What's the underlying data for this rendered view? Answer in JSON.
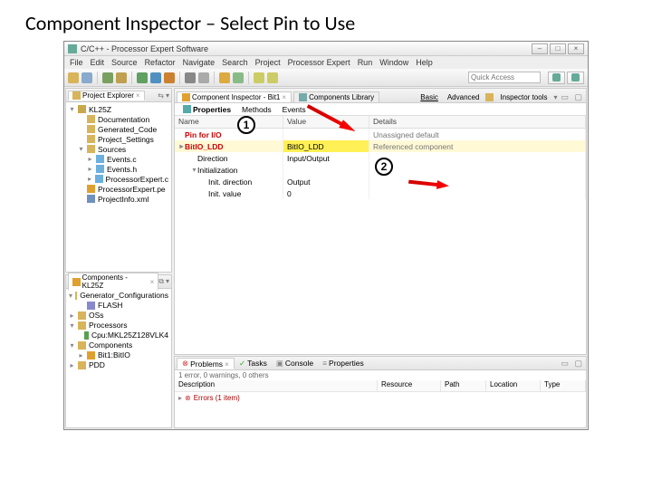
{
  "slide": {
    "title": "Component Inspector – Select Pin to Use"
  },
  "window": {
    "title": "C/C++ - Processor Expert Software"
  },
  "menu": {
    "file": "File",
    "edit": "Edit",
    "source": "Source",
    "refactor": "Refactor",
    "navigate": "Navigate",
    "search": "Search",
    "project": "Project",
    "pe": "Processor Expert",
    "run": "Run",
    "window": "Window",
    "help": "Help"
  },
  "quick_access": {
    "placeholder": "Quick Access"
  },
  "panels": {
    "project_explorer": {
      "tab": "Project Explorer",
      "items": [
        {
          "label": "KL25Z",
          "icon": "#c8a84a",
          "fold": "▾"
        },
        {
          "label": "Documentation",
          "icon": "#d8b45a",
          "fold": "",
          "indent": 1
        },
        {
          "label": "Generated_Code",
          "icon": "#d8b45a",
          "fold": "",
          "indent": 1
        },
        {
          "label": "Project_Settings",
          "icon": "#d8b45a",
          "fold": "",
          "indent": 1
        },
        {
          "label": "Sources",
          "icon": "#d8b45a",
          "fold": "▾",
          "indent": 1
        },
        {
          "label": "Events.c",
          "icon": "#6cb0e0",
          "fold": "▸",
          "indent": 2
        },
        {
          "label": "Events.h",
          "icon": "#6cb0e0",
          "fold": "▸",
          "indent": 2
        },
        {
          "label": "ProcessorExpert.c",
          "icon": "#6cb0e0",
          "fold": "▸",
          "indent": 2
        },
        {
          "label": "ProcessorExpert.pe",
          "icon": "#e0a030",
          "fold": "",
          "indent": 1
        },
        {
          "label": "ProjectInfo.xml",
          "icon": "#7090c0",
          "fold": "",
          "indent": 1
        }
      ]
    },
    "components": {
      "tab": "Components - KL25Z",
      "items": [
        {
          "label": "Generator_Configurations",
          "icon": "#d8b45a",
          "fold": "▾"
        },
        {
          "label": "FLASH",
          "icon": "#8888cc",
          "fold": "",
          "indent": 1
        },
        {
          "label": "OSs",
          "icon": "#d8b45a",
          "fold": "▸"
        },
        {
          "label": "Processors",
          "icon": "#d8b45a",
          "fold": "▾"
        },
        {
          "label": "Cpu:MKL25Z128VLK4",
          "icon": "#5aa050",
          "fold": "",
          "indent": 1
        },
        {
          "label": "Components",
          "icon": "#d8b45a",
          "fold": "▾"
        },
        {
          "label": "Bit1:BitIO",
          "icon": "#e0a030",
          "fold": "▸",
          "indent": 1
        },
        {
          "label": "PDD",
          "icon": "#d8b45a",
          "fold": "▸"
        }
      ]
    }
  },
  "inspector": {
    "tab1": "Component Inspector - Bit1",
    "tab2": "Components Library",
    "mode_basic": "Basic",
    "mode_advanced": "Advanced",
    "mode_tools": "Inspector tools",
    "subtabs": {
      "properties": "Properties",
      "methods": "Methods",
      "events": "Events"
    },
    "columns": {
      "name": "Name",
      "value": "Value",
      "details": "Details"
    },
    "rows": [
      {
        "name": "Pin for I/O",
        "value": "",
        "details": "Unassigned default",
        "hl": false,
        "indent": 0,
        "fold": "",
        "red": true
      },
      {
        "name": "BitIO_LDD",
        "value": "BitIO_LDD",
        "details": "Referenced component",
        "hl": true,
        "indent": 0,
        "fold": "▸",
        "red": true
      },
      {
        "name": "Direction",
        "value": "Input/Output",
        "details": "",
        "hl": false,
        "indent": 1,
        "fold": ""
      },
      {
        "name": "Initialization",
        "value": "",
        "details": "",
        "hl": false,
        "indent": 1,
        "fold": "▾"
      },
      {
        "name": "Init. direction",
        "value": "Output",
        "details": "",
        "hl": false,
        "indent": 2,
        "fold": ""
      },
      {
        "name": "Init. value",
        "value": "0",
        "details": "",
        "hl": false,
        "indent": 2,
        "fold": ""
      }
    ]
  },
  "problems": {
    "tabs": {
      "problems": "Problems",
      "tasks": "Tasks",
      "console": "Console",
      "properties": "Properties"
    },
    "summary": "1 error, 0 warnings, 0 others",
    "columns": {
      "desc": "Description",
      "res": "Resource",
      "path": "Path",
      "loc": "Location",
      "type": "Type"
    },
    "row": "Errors (1 item)"
  },
  "callouts": {
    "one": "1",
    "two": "2"
  }
}
